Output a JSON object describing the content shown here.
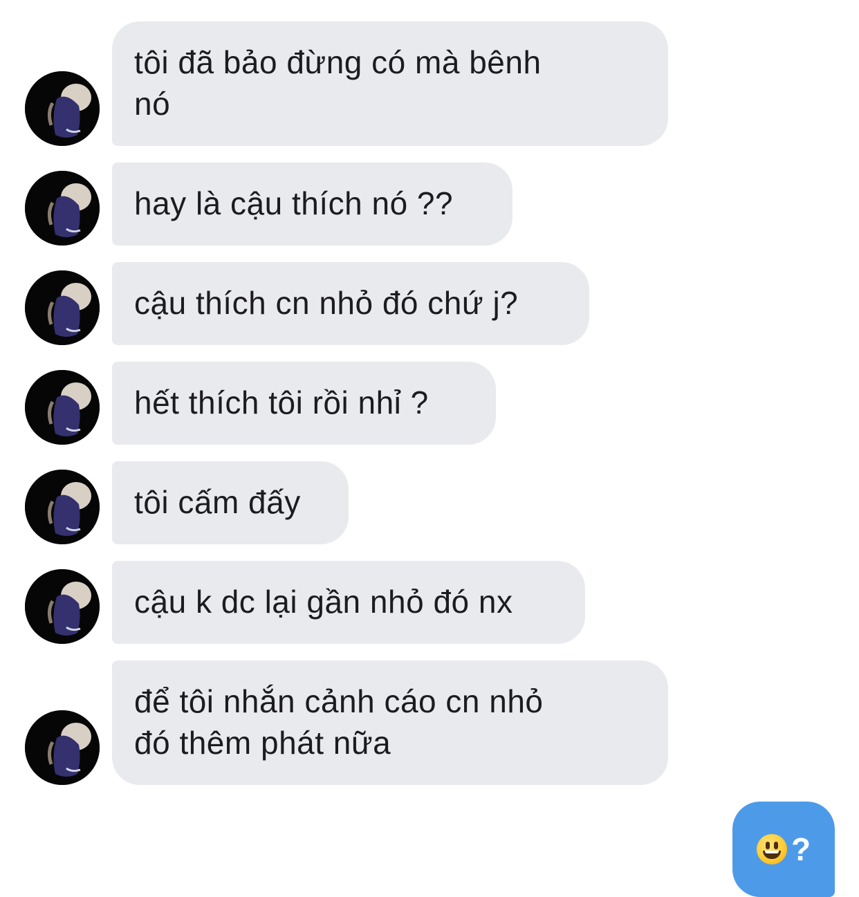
{
  "thread": {
    "incoming": [
      {
        "text": "tôi đã bảo đừng có mà bênh\nnó"
      },
      {
        "text": "hay là cậu thích nó ??"
      },
      {
        "text": "cậu thích cn nhỏ đó chứ j?"
      },
      {
        "text": "hết thích tôi rồi nhỉ ?"
      },
      {
        "text": "tôi cấm đấy"
      },
      {
        "text": "cậu k dc lại gần nhỏ đó nx"
      },
      {
        "text": "để tôi nhắn cảnh cáo cn nhỏ\nđó thêm phát nữa"
      }
    ],
    "outgoing": [
      {
        "emoji": "smiley-emoji",
        "text": "?"
      }
    ]
  },
  "colors": {
    "incoming_bubble": "#e8eaee",
    "outgoing_bubble": "#4d9be8",
    "incoming_text": "#1c1c1e",
    "outgoing_text": "#ffffff"
  }
}
